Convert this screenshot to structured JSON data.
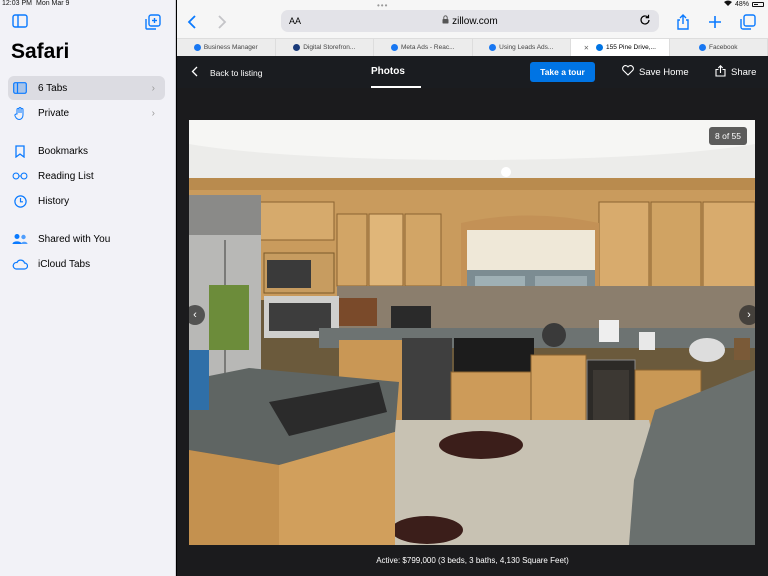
{
  "status": {
    "time": "12:03 PM",
    "date": "Mon Mar 9",
    "battery": "48%"
  },
  "sidebar": {
    "title": "Safari",
    "items": [
      {
        "label": "6 Tabs",
        "icon": "tabs-icon",
        "chevron": "›"
      },
      {
        "label": "Private",
        "icon": "hand-icon",
        "chevron": "›"
      },
      {
        "label": "Bookmarks",
        "icon": "book-icon"
      },
      {
        "label": "Reading List",
        "icon": "glasses-icon"
      },
      {
        "label": "History",
        "icon": "clock-icon"
      },
      {
        "label": "Shared with You",
        "icon": "people-icon"
      },
      {
        "label": "iCloud Tabs",
        "icon": "cloud-icon"
      }
    ]
  },
  "browser": {
    "url_prefix": "AA",
    "host": "zillow.com",
    "tabs": [
      {
        "label": "Business Manager",
        "favicon_color": "#1877f2"
      },
      {
        "label": "Digital Storefron...",
        "favicon_color": "#1a3b7a"
      },
      {
        "label": "Meta Ads - Reac...",
        "favicon_color": "#1877f2"
      },
      {
        "label": "Using Leads Ads...",
        "favicon_color": "#1877f2"
      },
      {
        "label": "155 Pine Drive,...",
        "favicon_color": "#0074e4",
        "close": "✕"
      },
      {
        "label": "Facebook",
        "favicon_color": "#1877f2"
      }
    ]
  },
  "zillow": {
    "back": "Back to listing",
    "tab_photos": "Photos",
    "tour": "Take a tour",
    "save": "Save Home",
    "share": "Share",
    "counter": "8 of 55",
    "caption": "Active: $799,000 (3 beds, 3 baths, 4,130 Square Feet)",
    "accent": "#0074e4"
  }
}
